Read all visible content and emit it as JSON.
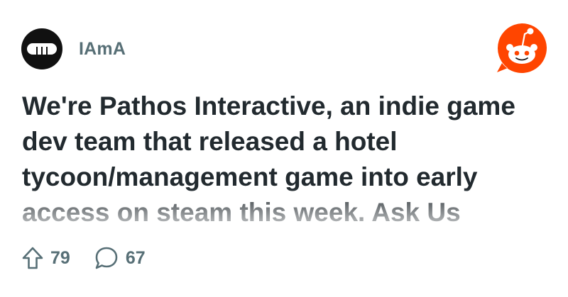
{
  "post": {
    "subreddit": "IAmA",
    "title": "We're Pathos Interactive, an indie game dev team that released a hotel tycoon/management game into early access on steam this week. Ask Us",
    "upvotes": "79",
    "comments": "67"
  },
  "icons": {
    "subreddit_avatar": "subreddit-ama-logo",
    "brand": "reddit-snoo-logo",
    "upvote": "upvote-arrow-icon",
    "comment": "comment-bubble-icon"
  },
  "colors": {
    "brand": "#ff4500",
    "meta_text": "#576f76",
    "title_text": "#222a2f"
  }
}
